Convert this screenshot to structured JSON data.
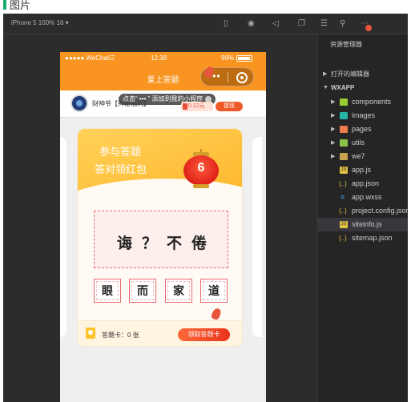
{
  "caption": {
    "text": "图片"
  },
  "toolbar": {
    "device_label": "iPhone 5 100% 16 ▾"
  },
  "statusbar": {
    "carrier": "●●●●● WeChat☷",
    "time": "12:38",
    "battery": "99%"
  },
  "navbar": {
    "title": "爱上答题",
    "capsule_dots": "•••"
  },
  "userbar": {
    "username": "财神爷【神秘福利】",
    "add_tip": "点击“ ••• ” 添加到我的小程序",
    "money": "0.12元",
    "withdraw": "提现"
  },
  "card": {
    "title_line1": "参与答题",
    "title_line2": "答对领红包",
    "lantern_number": "6",
    "puzzle": "诲？不倦",
    "choices": [
      "眼",
      "而",
      "家",
      "道"
    ],
    "cards_count": "答题卡：0 张",
    "claim_button": "领取答题卡"
  },
  "explorer": {
    "title": "资源管理器",
    "sections": [
      {
        "label": "打开的编辑器",
        "expanded": false
      },
      {
        "label": "WXAPP",
        "expanded": true
      }
    ],
    "items": [
      {
        "label": "components",
        "kind": "folder",
        "icon": "folder-components-icon"
      },
      {
        "label": "images",
        "kind": "folder",
        "icon": "folder-images-icon"
      },
      {
        "label": "pages",
        "kind": "folder",
        "icon": "folder-pages-icon"
      },
      {
        "label": "utils",
        "kind": "folder",
        "icon": "folder-utils-icon"
      },
      {
        "label": "we7",
        "kind": "folder",
        "icon": "folder-icon"
      },
      {
        "label": "app.js",
        "kind": "js",
        "icon": "js-file-icon"
      },
      {
        "label": "app.json",
        "kind": "json",
        "icon": "json-file-icon"
      },
      {
        "label": "app.wxss",
        "kind": "wxss",
        "icon": "wxss-file-icon"
      },
      {
        "label": "project.config.json",
        "kind": "json",
        "icon": "json-file-icon"
      },
      {
        "label": "siteinfo.js",
        "kind": "js",
        "icon": "js-file-icon",
        "selected": true
      },
      {
        "label": "sitemap.json",
        "kind": "json",
        "icon": "json-file-icon"
      }
    ]
  },
  "colors": {
    "accent": "#f8941f",
    "ide_bg": "#2c2c2c",
    "explorer_bg": "#252526",
    "red": "#e8331c"
  }
}
